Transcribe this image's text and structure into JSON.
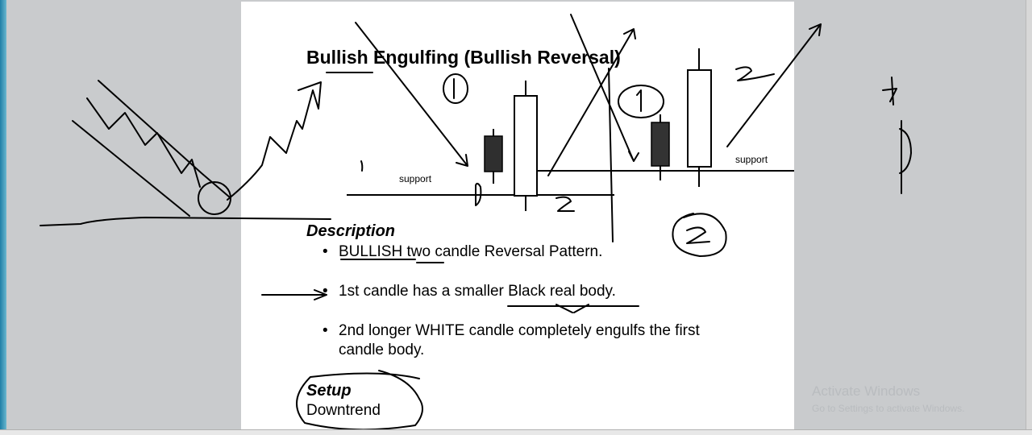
{
  "slide": {
    "title": "Bullish Engulfing (Bullish Reversal)",
    "support_label_left": "support",
    "support_label_right": "support",
    "description_heading": "Description",
    "bullets": [
      "BULLISH two candle Reversal Pattern.",
      "1st candle has a smaller Black real body.",
      "2nd longer WHITE candle completely engulfs the first candle body."
    ],
    "setup_heading": "Setup",
    "setup_text": "Downtrend"
  },
  "watermark": {
    "title": "Activate Windows",
    "subtitle": "Go to Settings to activate Windows."
  }
}
